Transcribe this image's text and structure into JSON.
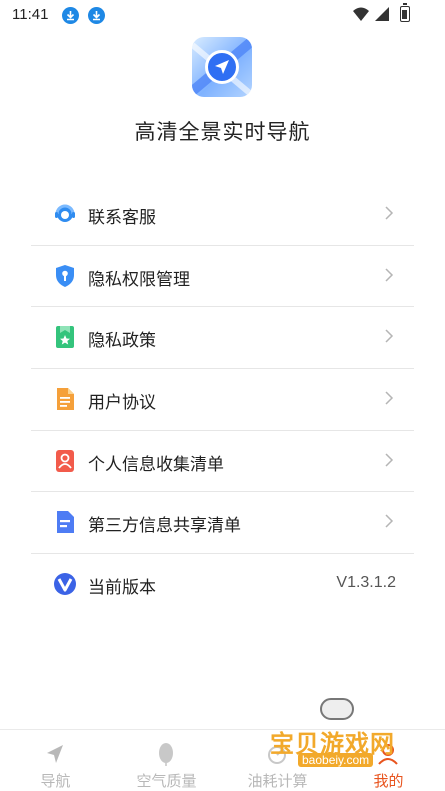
{
  "status_bar": {
    "time": "11:41",
    "icons": [
      "download-icon",
      "download-icon",
      "wifi-icon",
      "signal-icon",
      "battery-icon"
    ]
  },
  "app": {
    "title": "高清全景实时导航",
    "logo_icon": "navigation-compass-icon"
  },
  "menu": {
    "items": [
      {
        "label": "联系客服",
        "icon": "customer-service-icon",
        "color": "#2f8cf0"
      },
      {
        "label": "隐私权限管理",
        "icon": "privacy-shield-icon",
        "color": "#3a8ef5"
      },
      {
        "label": "隐私政策",
        "icon": "bookmark-star-icon",
        "color": "#34c47c"
      },
      {
        "label": "用户协议",
        "icon": "document-icon",
        "color": "#f5a03a"
      },
      {
        "label": "个人信息收集清单",
        "icon": "person-card-icon",
        "color": "#f25b4b"
      },
      {
        "label": "第三方信息共享清单",
        "icon": "share-document-icon",
        "color": "#4e7cf4"
      },
      {
        "label": "当前版本",
        "icon": "version-icon",
        "color": "#3b63e6"
      }
    ],
    "version": "V1.3.1.2"
  },
  "bottom_nav": {
    "tabs": [
      {
        "label": "导航",
        "icon": "navigation-arrow-icon"
      },
      {
        "label": "空气质量",
        "icon": "leaf-icon"
      },
      {
        "label": "油耗计算",
        "icon": "fuel-icon"
      },
      {
        "label": "我的",
        "icon": "profile-icon"
      }
    ],
    "active_color": "#e8541e",
    "inactive_color": "#b8b8b8"
  },
  "watermark": {
    "text": "宝贝游戏网",
    "url": "baobeiy.com"
  }
}
